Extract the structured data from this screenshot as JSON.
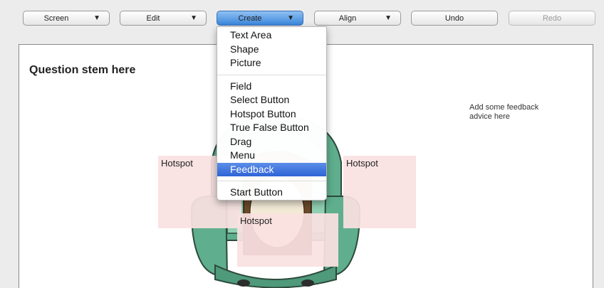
{
  "toolbar": {
    "screen": "Screen",
    "edit": "Edit",
    "create": "Create",
    "align": "Align",
    "undo": "Undo",
    "redo": "Redo",
    "arrow": "▼"
  },
  "canvas": {
    "question_stem": "Question stem here",
    "feedback_advice": "Add some feedback advice here",
    "hotspots": [
      "Hotspot",
      "Hotspot",
      "Hotspot"
    ]
  },
  "create_menu": {
    "group1": [
      "Text Area",
      "Shape",
      "Picture"
    ],
    "group2": [
      "Field",
      "Select Button",
      "Hotspot Button",
      "True False Button",
      "Drag",
      "Menu",
      "Feedback"
    ],
    "group3": [
      "Start Button"
    ],
    "selected": "Feedback"
  },
  "colors": {
    "active_button": "#3a86dc",
    "hotspot_fill": "#fae1e1",
    "menu_highlight": "#2f64d6",
    "chair_green": "#5fae8e"
  }
}
